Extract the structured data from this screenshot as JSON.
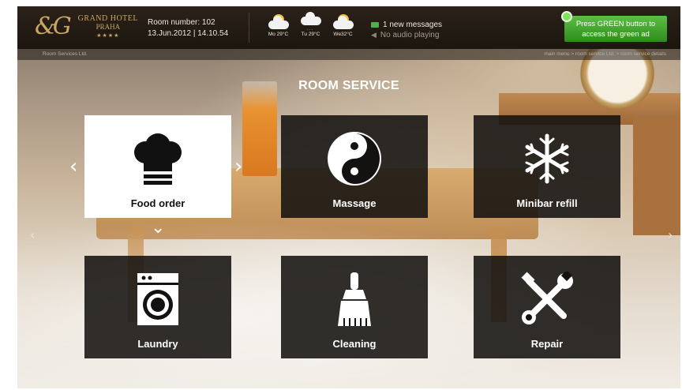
{
  "hotel": {
    "logo_mark": "&G",
    "name": "GRAND HOTEL",
    "city": "PRAHA",
    "stars": "★★★★"
  },
  "room": {
    "number_label": "Room number: 102",
    "datetime": "13.Jun.2012 | 14.10.54"
  },
  "weather": [
    {
      "label": "Mo 29°C",
      "icon": "partly-cloudy-icon"
    },
    {
      "label": "Tu 29°C",
      "icon": "cloud-rain-icon"
    },
    {
      "label": "We32°C",
      "icon": "partly-cloudy-icon"
    }
  ],
  "status": {
    "messages": "1 new messages",
    "audio": "No audio playing"
  },
  "green_ad": {
    "line1": "Press GREEN button to",
    "line2": "access the green ad"
  },
  "subbar": {
    "company": "Room Services Ltd.",
    "breadcrumb": "main menu > room service Ltd. > room service details"
  },
  "page_title": "ROOM SERVICE",
  "tiles": [
    {
      "label": "Food order",
      "icon": "chef-hat-icon",
      "selected": true
    },
    {
      "label": "Massage",
      "icon": "yin-yang-icon",
      "selected": false
    },
    {
      "label": "Minibar refill",
      "icon": "snowflake-icon",
      "selected": false
    },
    {
      "label": "Laundry",
      "icon": "washing-machine-icon",
      "selected": false
    },
    {
      "label": "Cleaning",
      "icon": "brush-icon",
      "selected": false
    },
    {
      "label": "Repair",
      "icon": "tools-icon",
      "selected": false
    }
  ],
  "nav_glyphs": {
    "left": "‹",
    "right": "›",
    "down": "⌄"
  },
  "colors": {
    "accent_green": "#4caf50",
    "tile_dark": "#141210",
    "logo_gold": "#c9a75f"
  }
}
